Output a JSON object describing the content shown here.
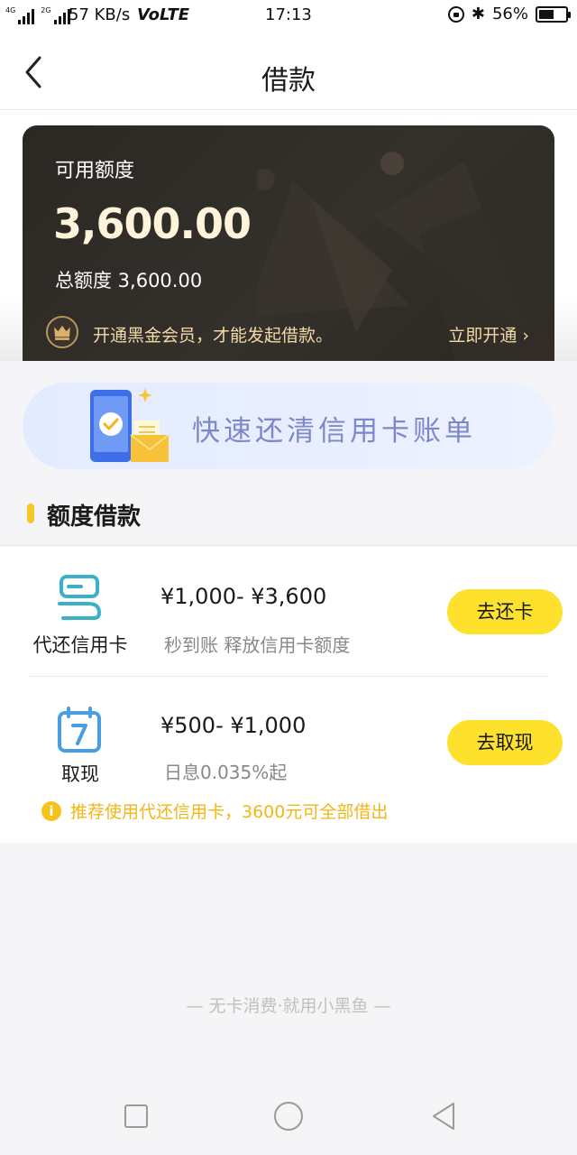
{
  "status_bar": {
    "net_4g": "4G",
    "net_2g": "2G",
    "speed": "57 KB/s",
    "volte": "VoLTE",
    "time": "17:13",
    "bluetooth": "✱",
    "battery_text": "56%",
    "battery_level": 0.56
  },
  "nav": {
    "title": "借款",
    "back_icon": "chevron-left-icon"
  },
  "card": {
    "available_label": "可用额度",
    "available_amount": "3,600.00",
    "total_label": "总额度 3,600.00",
    "member_text": "开通黑金会员，才能发起借款。",
    "open_link": "立即开通",
    "open_chevron": "›",
    "crown_icon": "crown-icon",
    "colors": {
      "background": "#2e2a26",
      "gold": "#f3d9a8"
    }
  },
  "banner": {
    "text": "快速还清信用卡账单",
    "icon": "phone-check-envelope-icon"
  },
  "section": {
    "title": "额度借款"
  },
  "loan_options": [
    {
      "icon": "repay-card-icon",
      "label": "代还信用卡",
      "range": "¥1,000- ¥3,600",
      "description": "秒到账 释放信用卡额度",
      "button": "去还卡"
    },
    {
      "icon": "calendar-7-icon",
      "label": "取现",
      "range": "¥500- ¥1,000",
      "description": "日息0.035%起",
      "button": "去取现"
    }
  ],
  "tip": {
    "info_glyph": "i",
    "text": "推荐使用代还信用卡，3600元可全部借出"
  },
  "footer": {
    "slogan": "— 无卡消费·就用小黑鱼 —"
  },
  "colors": {
    "accent_yellow": "#fde12d",
    "tip_orange": "#f2b618",
    "icon_blue": "#4a9ee0",
    "icon_teal": "#3bb0c9"
  }
}
